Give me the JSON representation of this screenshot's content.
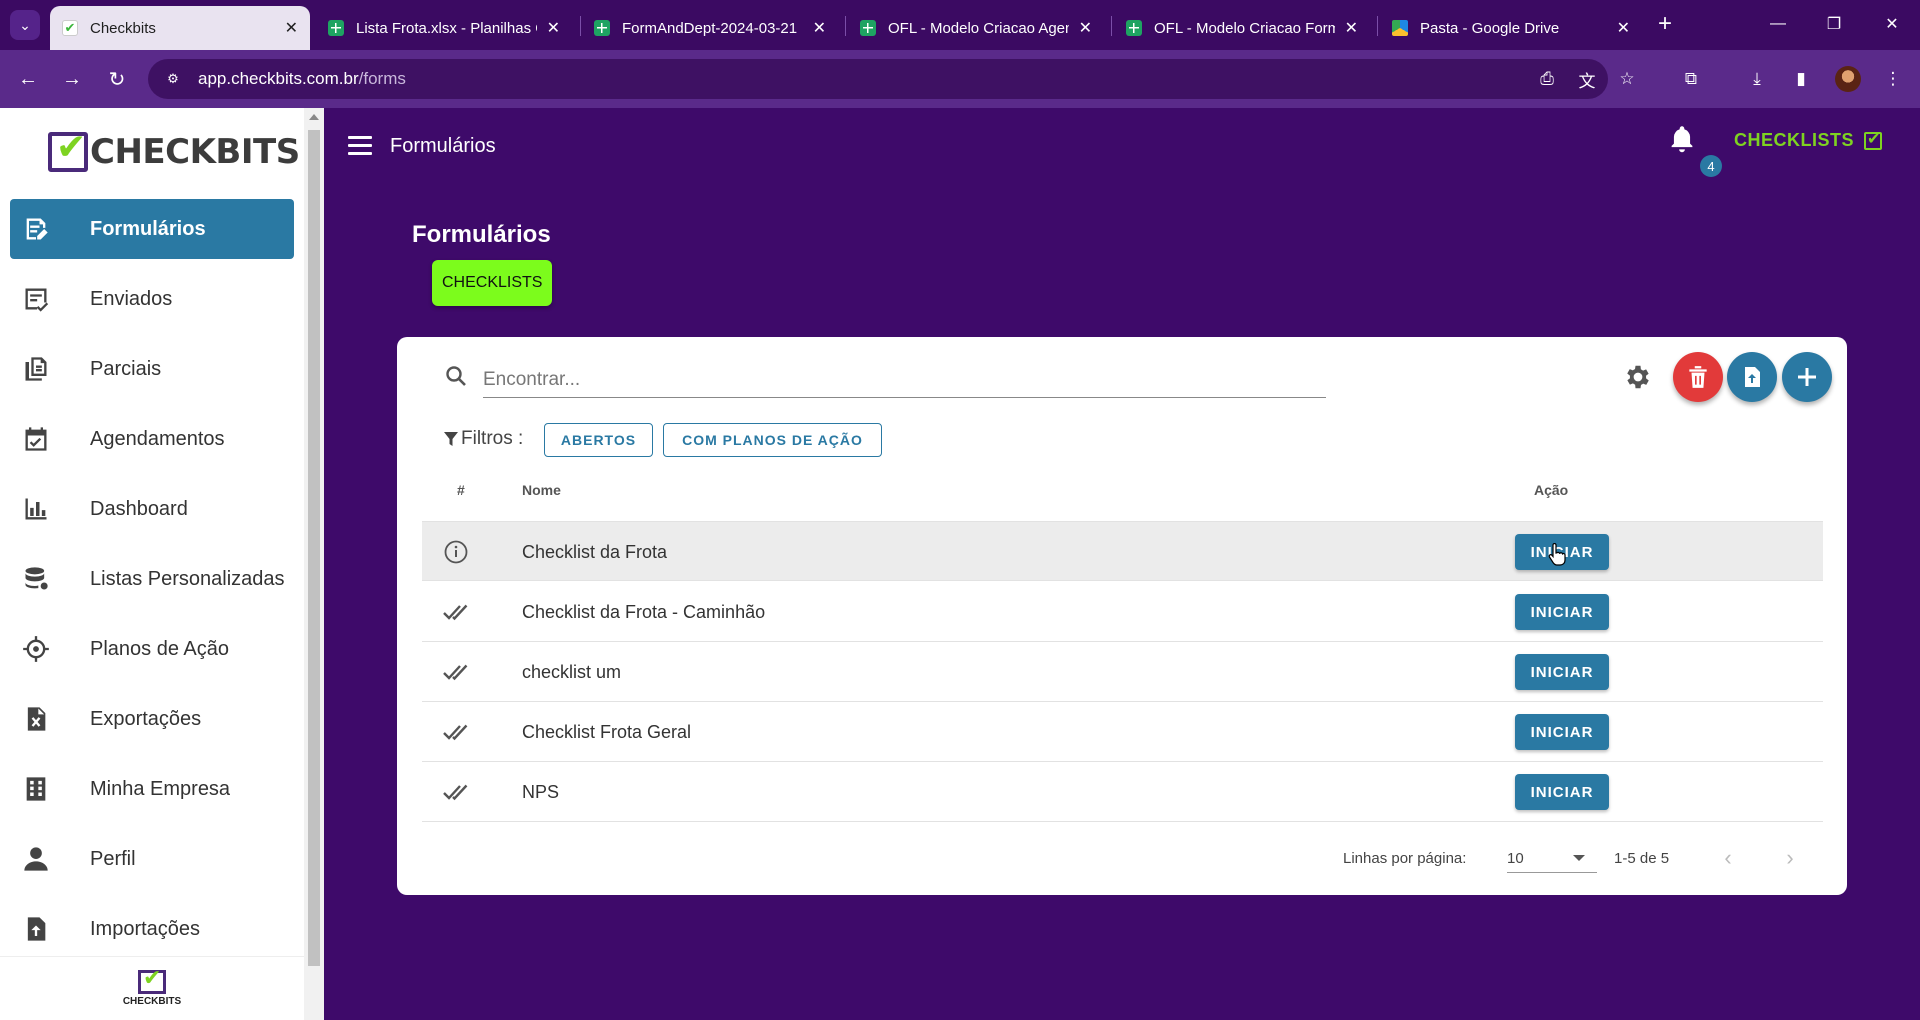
{
  "browser": {
    "tabs": [
      {
        "title": "Checkbits",
        "favicon": "checkbits-icon",
        "active": true
      },
      {
        "title": "Lista Frota.xlsx - Planilhas G",
        "favicon": "sheets-icon"
      },
      {
        "title": "FormAndDept-2024-03-21",
        "favicon": "sheets-icon"
      },
      {
        "title": "OFL - Modelo Criacao Agen",
        "favicon": "sheets-icon"
      },
      {
        "title": "OFL - Modelo Criacao Form",
        "favicon": "sheets-icon"
      },
      {
        "title": "Pasta - Google Drive",
        "favicon": "drive-icon"
      }
    ],
    "url_host": "app.checkbits.com.br",
    "url_path": "/forms"
  },
  "sidebar": {
    "logo_text": "CHECKBITS",
    "footer_logo_text": "CHECKBITS",
    "items": [
      {
        "label": "Formulários",
        "icon": "form-edit-icon",
        "active": true
      },
      {
        "label": "Enviados",
        "icon": "sent-list-icon"
      },
      {
        "label": "Parciais",
        "icon": "partial-docs-icon"
      },
      {
        "label": "Agendamentos",
        "icon": "calendar-check-icon"
      },
      {
        "label": "Dashboard",
        "icon": "bar-chart-icon"
      },
      {
        "label": "Listas Personalizadas",
        "icon": "database-icon"
      },
      {
        "label": "Planos de Ação",
        "icon": "crosshair-icon"
      },
      {
        "label": "Exportações",
        "icon": "excel-file-icon"
      },
      {
        "label": "Minha Empresa",
        "icon": "building-icon"
      },
      {
        "label": "Perfil",
        "icon": "person-icon"
      },
      {
        "label": "Importações",
        "icon": "file-import-icon"
      }
    ]
  },
  "header": {
    "title": "Formulários",
    "notification_count": "4",
    "checklists_label": "CHECKLISTS"
  },
  "main": {
    "page_title": "Formulários",
    "category_chip": "CHECKLISTS",
    "search_placeholder": "Encontrar...",
    "filters_label": "Filtros :",
    "filters": [
      "ABERTOS",
      "COM PLANOS DE AÇÃO"
    ],
    "columns": {
      "index": "#",
      "name": "Nome",
      "action": "Ação"
    },
    "rows": [
      {
        "name": "Checklist da Frota",
        "status_icon": "info-icon",
        "action": "INICIAR"
      },
      {
        "name": "Checklist da Frota - Caminhão",
        "status_icon": "double-check-icon",
        "action": "INICIAR"
      },
      {
        "name": "checklist um",
        "status_icon": "double-check-icon",
        "action": "INICIAR"
      },
      {
        "name": "Checklist Frota Geral",
        "status_icon": "double-check-icon",
        "action": "INICIAR"
      },
      {
        "name": "NPS",
        "status_icon": "double-check-icon",
        "action": "INICIAR"
      }
    ],
    "pagination": {
      "rows_per_page_label": "Linhas por página:",
      "rows_per_page": "10",
      "range": "1-5 de 5"
    }
  },
  "colors": {
    "background": "#3e0a6a",
    "primary": "#2a79a3",
    "accent_green": "#7cfc1c",
    "danger": "#e23a3a"
  }
}
